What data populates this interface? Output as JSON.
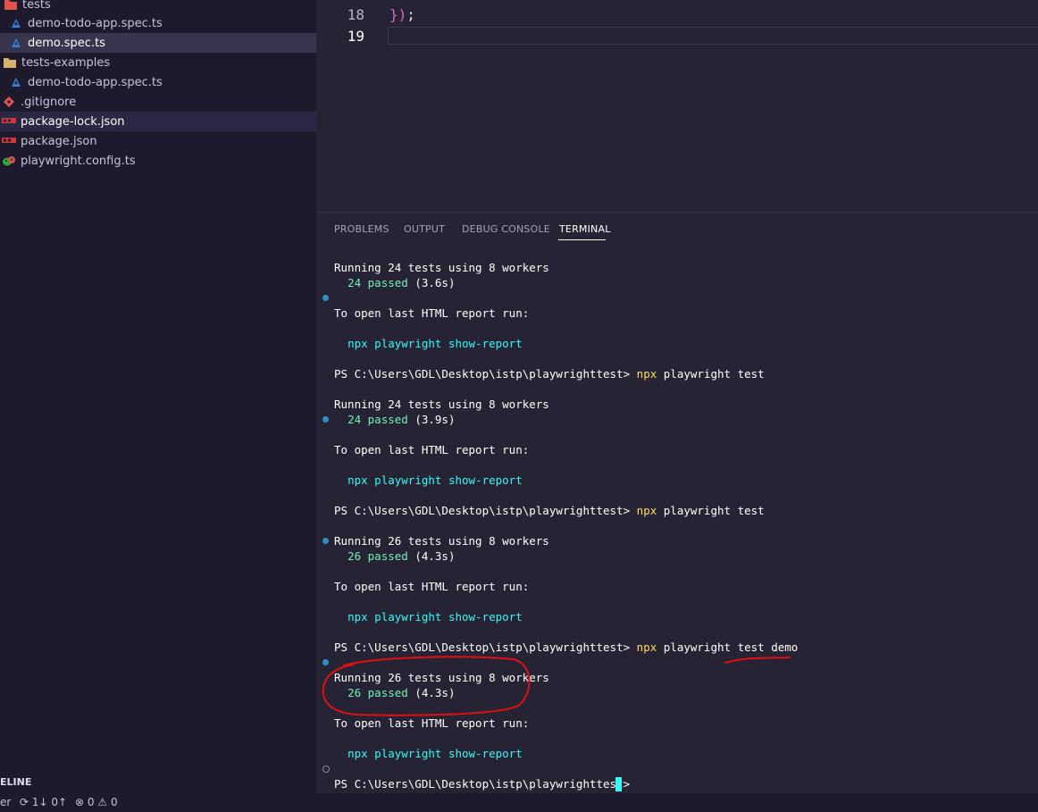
{
  "explorer": {
    "items": [
      {
        "label": "tests",
        "icon": "folder-tests-icon"
      },
      {
        "label": "demo-todo-app.spec.ts",
        "icon": "playwright-icon"
      },
      {
        "label": "demo.spec.ts",
        "icon": "playwright-icon"
      },
      {
        "label": "tests-examples",
        "icon": "folder-icon"
      },
      {
        "label": "demo-todo-app.spec.ts",
        "icon": "playwright-icon"
      },
      {
        "label": ".gitignore",
        "icon": "git-icon"
      },
      {
        "label": "package-lock.json",
        "icon": "npm-icon"
      },
      {
        "label": "package.json",
        "icon": "npm-icon"
      },
      {
        "label": "playwright.config.ts",
        "icon": "playwright-config-icon"
      }
    ],
    "timeline_label": "ELINE"
  },
  "editor": {
    "lines": [
      {
        "number": "18",
        "code": "});"
      },
      {
        "number": "19",
        "code": ""
      }
    ]
  },
  "panel": {
    "tabs": [
      "PROBLEMS",
      "OUTPUT",
      "DEBUG CONSOLE",
      "TERMINAL"
    ],
    "active_tab": "TERMINAL"
  },
  "terminal": {
    "prompt": "PS C:\\Users\\GDL\\Desktop\\istp\\playwrighttest>",
    "report_line": "To open last HTML report run:",
    "report_cmd_npx": "npx playwright",
    "report_cmd_rest": "show-report",
    "runs": [
      {
        "running": "Running 24 tests using 8 workers",
        "passed": "24 passed",
        "time": "(3.6s)"
      },
      {
        "running": "Running 24 tests using 8 workers",
        "passed": "24 passed",
        "time": "(3.9s)"
      },
      {
        "running": "Running 26 tests using 8 workers",
        "passed": "26 passed",
        "time": "(4.3s)"
      },
      {
        "running": "Running 26 tests using 8 workers",
        "passed": "26 passed",
        "time": "(4.3s)"
      }
    ],
    "commands": [
      {
        "npx": "npx",
        "rest": "playwright test"
      },
      {
        "npx": "npx",
        "rest": "playwright test"
      },
      {
        "npx": "npx",
        "rest": "playwright test demo"
      }
    ]
  },
  "statusbar": {
    "left_fragment": "er",
    "sync": "1↓ 0↑",
    "errors": "0",
    "warnings": "0"
  },
  "colors": {
    "background": "#262335",
    "sidebar": "#1e1a2e",
    "passed": "#72f1b8",
    "link": "#36f9f6",
    "command": "#fede5d",
    "annotation": "#e01010"
  }
}
